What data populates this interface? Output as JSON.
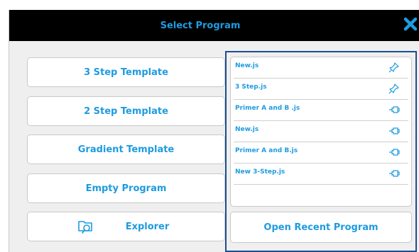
{
  "dialog": {
    "title": "Select Program",
    "close_icon": "close-x-icon",
    "accent": "#1e9be0",
    "panel_border": "#1a4f8f"
  },
  "templates": [
    {
      "label": "3 Step Template"
    },
    {
      "label": "2 Step Template"
    },
    {
      "label": "Gradient Template"
    },
    {
      "label": "Empty Program"
    },
    {
      "label": "Explorer",
      "icon": "folder-search-icon"
    }
  ],
  "recent": {
    "items": [
      {
        "name": "New.js",
        "icon": "pin-icon",
        "pinned": true
      },
      {
        "name": "3 Step.js",
        "icon": "pin-icon",
        "pinned": true
      },
      {
        "name": "Primer A and B .js",
        "icon": "unpinned-pin-icon",
        "pinned": false
      },
      {
        "name": "New.js",
        "icon": "unpinned-pin-icon",
        "pinned": false
      },
      {
        "name": "Primer A and B.js",
        "icon": "unpinned-pin-icon",
        "pinned": false
      },
      {
        "name": "New 3-Step.js",
        "icon": "unpinned-pin-icon",
        "pinned": false
      }
    ],
    "open_label": "Open Recent Program"
  }
}
